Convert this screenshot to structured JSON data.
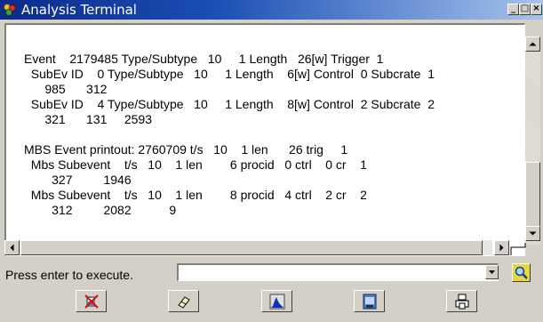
{
  "window": {
    "title": "Analysis Terminal",
    "controls": {
      "minimize": "_",
      "maximize": "□",
      "close": "×"
    }
  },
  "terminal": {
    "lines": [
      "Event    2179485 Type/Subtype   10     1 Length   26[w] Trigger  1",
      "  SubEv ID    0 Type/Subtype   10     1 Length    6[w] Control  0 Subcrate  1",
      "      985      312",
      "  SubEv ID    4 Type/Subtype   10     1 Length    8[w] Control  2 Subcrate  2",
      "      321      131     2593",
      "",
      "MBS Event printout: 2760709 t/s   10    1 len      26 trig     1",
      "  Mbs Subevent    t/s   10    1 len        6 procid   0 ctrl    0 cr    1",
      "        327         1946",
      "  Mbs Subevent    t/s   10    1 len        8 procid   4 ctrl    2 cr    2",
      "        312         2082           9"
    ]
  },
  "command": {
    "label": "Press enter to execute.",
    "value": ""
  },
  "toolbar": {
    "buttons": [
      {
        "name": "clear-output-button",
        "icon": "clear-icon"
      },
      {
        "name": "erase-button",
        "icon": "eraser-icon"
      },
      {
        "name": "histogram-button",
        "icon": "histogram-icon"
      },
      {
        "name": "save-button",
        "icon": "window-icon"
      },
      {
        "name": "print-button",
        "icon": "printer-icon"
      }
    ]
  },
  "colors": {
    "titlebar_start": "#0c2a8a",
    "titlebar_end": "#a6c4ec",
    "face": "#d4d0c8"
  }
}
